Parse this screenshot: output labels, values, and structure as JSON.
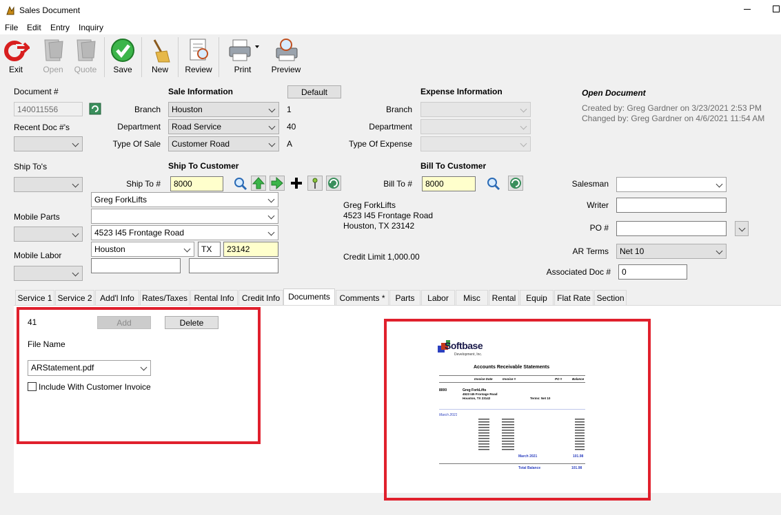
{
  "window": {
    "title": "Sales Document"
  },
  "menu": [
    "File",
    "Edit",
    "Entry",
    "Inquiry"
  ],
  "toolbar": {
    "exit": "Exit",
    "open": "Open",
    "quote": "Quote",
    "save": "Save",
    "new": "New",
    "review": "Review",
    "print": "Print",
    "preview": "Preview"
  },
  "document": {
    "doc_label": "Document #",
    "doc_number": "140011556",
    "recent_label": "Recent Doc #'s",
    "ship_tos_label": "Ship To's",
    "mobile_parts_label": "Mobile Parts",
    "mobile_labor_label": "Mobile Labor"
  },
  "sale_info": {
    "heading": "Sale Information",
    "default_button": "Default",
    "branch_label": "Branch",
    "branch": "Houston",
    "branch_code": "1",
    "department_label": "Department",
    "department": "Road Service",
    "department_code": "40",
    "type_label": "Type Of Sale",
    "type": "Customer Road",
    "type_code": "A"
  },
  "expense_info": {
    "heading": "Expense Information",
    "branch_label": "Branch",
    "department_label": "Department",
    "type_label": "Type Of Expense"
  },
  "status": {
    "heading": "Open Document",
    "created": "Created by: Greg Gardner on 3/23/2021 2:53 PM",
    "changed": "Changed by: Greg Gardner on 4/6/2021 11:54 AM"
  },
  "ship_to": {
    "heading": "Ship To Customer",
    "label": "Ship To #",
    "number": "8000",
    "name": "Greg ForkLifts",
    "address2": "",
    "street": "4523 I45 Frontage Road",
    "city": "Houston",
    "state": "TX",
    "zip": "23142"
  },
  "bill_to": {
    "heading": "Bill To Customer",
    "label": "Bill To #",
    "number": "8000",
    "addr_name": "Greg ForkLifts",
    "addr_street": "4523 I45 Frontage Road",
    "addr_city": "Houston, TX  23142",
    "credit_limit": "Credit Limit 1,000.00"
  },
  "right_fields": {
    "salesman_label": "Salesman",
    "writer_label": "Writer",
    "po_label": "PO #",
    "ar_terms_label": "AR Terms",
    "ar_terms": "Net 10",
    "assoc_label": "Associated Doc #",
    "assoc_value": "0"
  },
  "tabs": [
    "Service 1",
    "Service 2",
    "Add'l Info",
    "Rates/Taxes",
    "Rental Info",
    "Credit Info",
    "Documents",
    "Comments *",
    "Parts",
    "Labor",
    "Misc",
    "Rental",
    "Equip",
    "Flat Rate",
    "Section"
  ],
  "documents_tab": {
    "count": "41",
    "add_button": "Add",
    "delete_button": "Delete",
    "file_name_label": "File Name",
    "file_name": "ARStatement.pdf",
    "include_label": "Include With Customer Invoice"
  },
  "preview_doc": {
    "logo_text": "Softbase",
    "logo_sub": "Development, Inc.",
    "title": "Accounts Receivable Statements",
    "col_invoice_date": "Invoice Date",
    "col_invoice_num": "Invoice #",
    "col_po": "PO #",
    "col_balance": "Balance",
    "cust_num": "8000",
    "cust_name": "Greg ForkLifts",
    "cust_street": "4523 I45 Frontage Road",
    "cust_city": "Houston, TX 23142",
    "terms": "Terms: Net 10",
    "month": "March 2021",
    "month_total_label": "March 2021",
    "month_total": "101.98",
    "total_label": "Total Balance",
    "total": "101.98"
  },
  "colors": {
    "highlight_red": "#e0202d",
    "yellow_field": "#ffffcc",
    "doc_blue": "#2b3fbf"
  },
  "icons": [
    "exit-icon",
    "open-icon",
    "quote-icon",
    "save-check-icon",
    "new-broom-icon",
    "review-icon",
    "print-icon",
    "preview-icon",
    "refresh-icon",
    "search-icon",
    "up-arrow-icon",
    "right-arrow-icon",
    "plus-icon",
    "pin-icon"
  ]
}
